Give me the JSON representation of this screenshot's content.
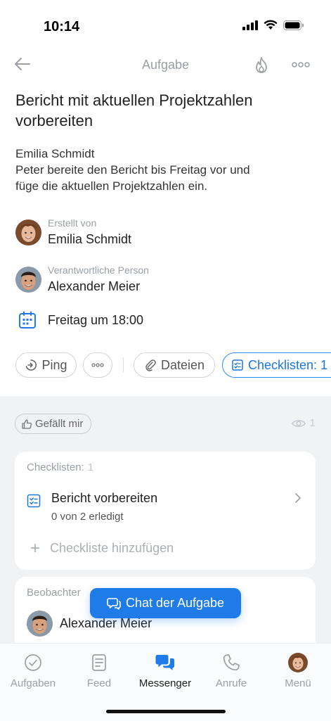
{
  "status_bar": {
    "time": "10:14"
  },
  "nav": {
    "title": "Aufgabe"
  },
  "task": {
    "title": "Bericht mit aktuellen Projektzahlen vorbereiten",
    "description_lines": [
      "Emilia Schmidt",
      "Peter bereite den Bericht bis Freitag vor und",
      "füge die aktuellen Projektzahlen ein."
    ],
    "created_by_label": "Erstellt von",
    "created_by_name": "Emilia Schmidt",
    "responsible_label": "Verantwortliche Person",
    "responsible_name": "Alexander Meier",
    "deadline": "Freitag um 18:00"
  },
  "actions": {
    "ping": "Ping",
    "files": "Dateien",
    "checklists": "Checklisten: 1"
  },
  "social": {
    "like": "Gefällt mir",
    "views": "1"
  },
  "checklists_card": {
    "title": "Checklisten:",
    "count": "1",
    "item_title": "Bericht vorbereiten",
    "item_progress": "0 von 2 erledigt",
    "add_label": "Checkliste hinzufügen"
  },
  "observers_card": {
    "title": "Beobachter",
    "observer_name": "Alexander Meier"
  },
  "chat_button": "Chat der Aufgabe",
  "tabs": [
    {
      "label": "Aufgaben",
      "icon": "check-circle-icon"
    },
    {
      "label": "Feed",
      "icon": "feed-icon"
    },
    {
      "label": "Messenger",
      "icon": "messenger-icon"
    },
    {
      "label": "Anrufe",
      "icon": "phone-icon"
    },
    {
      "label": "Menü",
      "icon": "avatar"
    }
  ],
  "colors": {
    "accent": "#1f7be8",
    "background_gray": "#f1f2f4"
  }
}
